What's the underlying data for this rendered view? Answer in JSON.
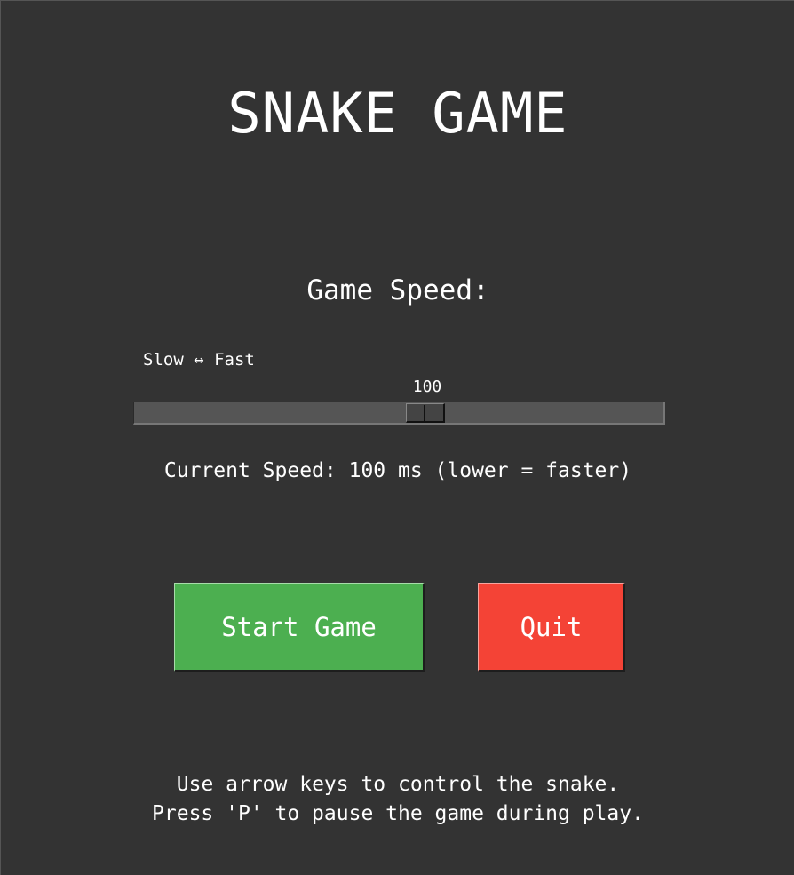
{
  "title": "SNAKE GAME",
  "speed_section": {
    "heading": "Game Speed:",
    "slider_caption": "Slow ↔ Fast",
    "slider_value": "100",
    "slider_fraction": 0.5,
    "current_speed_text": "Current Speed: 100 ms (lower = faster)"
  },
  "buttons": {
    "start_label": "Start Game",
    "quit_label": "Quit"
  },
  "colors": {
    "background": "#333333",
    "start_button": "#4caf50",
    "quit_button": "#f44336",
    "text": "#ffffff"
  },
  "instructions": {
    "line1": "Use arrow keys to control the snake.",
    "line2": "Press 'P' to pause the game during play."
  }
}
